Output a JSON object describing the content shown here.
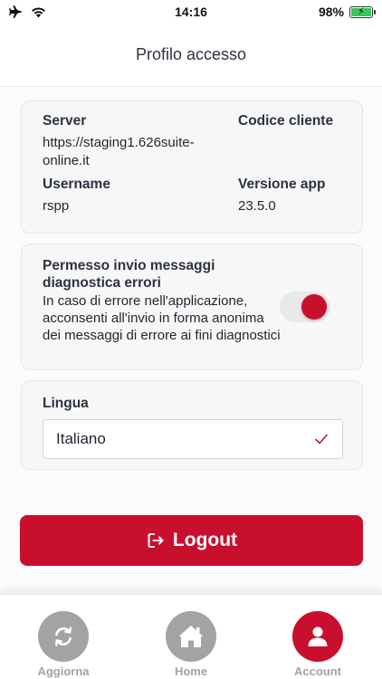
{
  "status_bar": {
    "time": "14:16",
    "battery": "98%"
  },
  "header": {
    "title": "Profilo accesso"
  },
  "info": {
    "server_label": "Server",
    "server_value_line1": "https://staging1.626suite-",
    "server_value_line2": "online.it",
    "codice_label": "Codice cliente",
    "username_label": "Username",
    "username_value": "rspp",
    "versione_label": "Versione app",
    "versione_value": "23.5.0"
  },
  "diagnostics": {
    "title": "Permesso invio messaggi diagnostica errori",
    "description": "In caso di errore nell'applicazione, acconsenti all'invio in forma anonima dei messaggi di errore ai fini diagnostici",
    "enabled": true
  },
  "language": {
    "label": "Lingua",
    "selected": "Italiano"
  },
  "logout": {
    "label": "Logout"
  },
  "tabs": [
    {
      "label": "Aggiorna",
      "icon": "refresh-icon",
      "active": false
    },
    {
      "label": "Home",
      "icon": "home-icon",
      "active": false
    },
    {
      "label": "Account",
      "icon": "user-icon",
      "active": true
    }
  ],
  "colors": {
    "accent": "#c8102e",
    "inactive": "#a3a3a6"
  }
}
